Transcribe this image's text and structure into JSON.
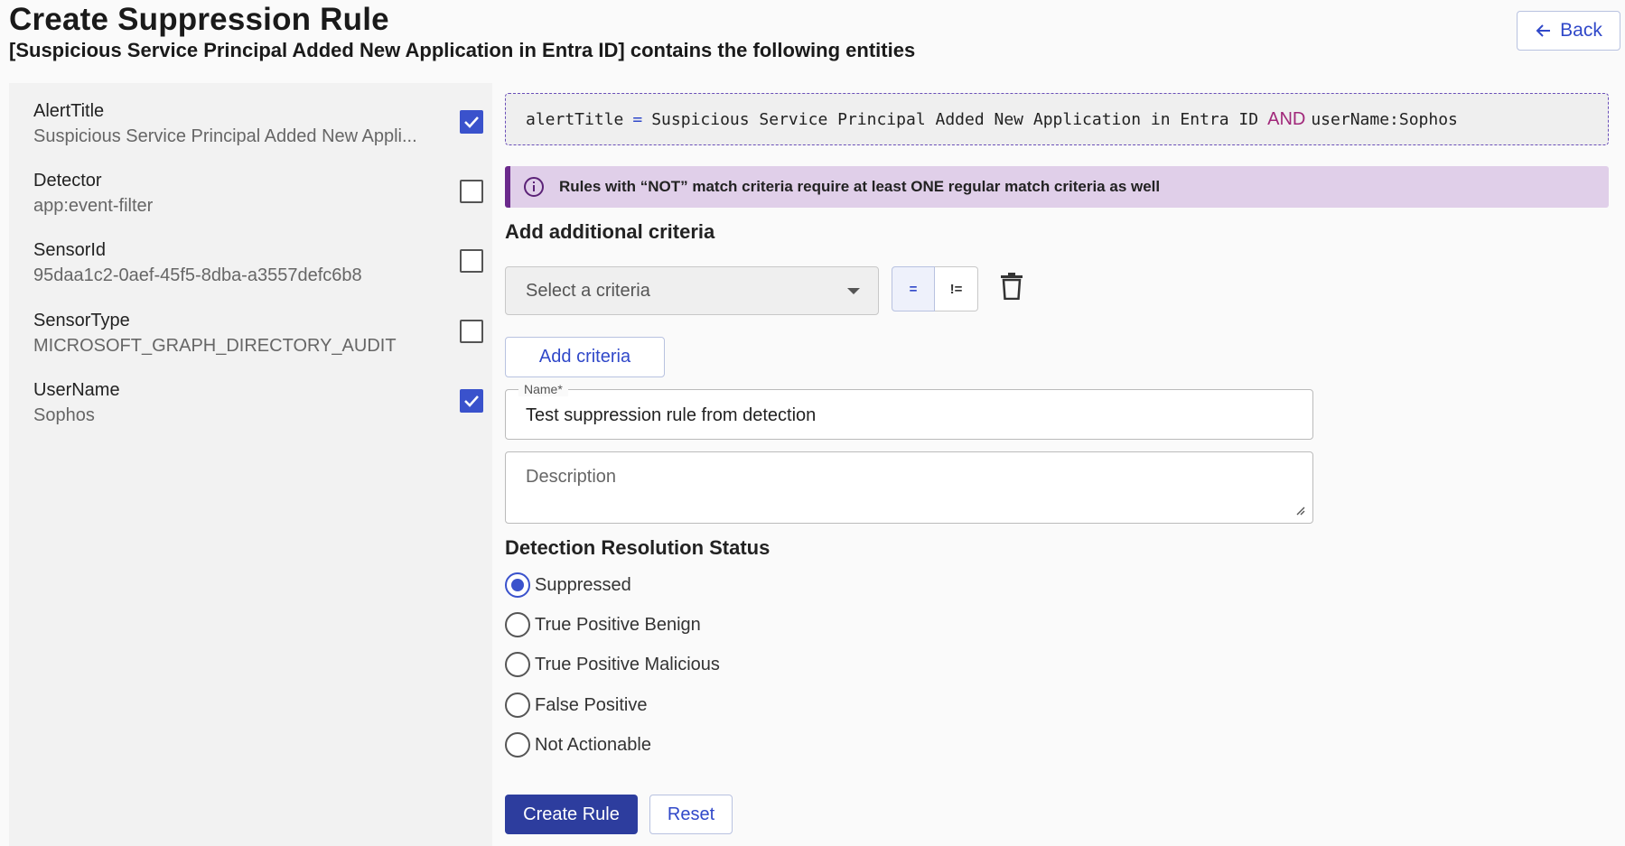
{
  "header": {
    "title": "Create Suppression Rule",
    "subtitle": "[Suspicious Service Principal Added New Application in Entra ID] contains the following entities",
    "back_label": "Back"
  },
  "entities": [
    {
      "key": "AlertTitle",
      "value": "Suspicious Service Principal Added New Appli...",
      "checked": true
    },
    {
      "key": "Detector",
      "value": "app:event-filter",
      "checked": false
    },
    {
      "key": "SensorId",
      "value": "95daa1c2-0aef-45f5-8dba-a3557defc6b8",
      "checked": false
    },
    {
      "key": "SensorType",
      "value": "MICROSOFT_GRAPH_DIRECTORY_AUDIT",
      "checked": false
    },
    {
      "key": "UserName",
      "value": "Sophos",
      "checked": true
    }
  ],
  "query": {
    "field1": "alertTitle",
    "op1": "=",
    "value1": "Suspicious Service Principal Added New Application in Entra ID",
    "joiner": "AND",
    "clause2": "userName:Sophos"
  },
  "info_banner": {
    "text": "Rules with “NOT” match criteria require at least ONE regular match criteria as well"
  },
  "criteria": {
    "section_title": "Add additional criteria",
    "select_placeholder": "Select a criteria",
    "op_equals": "=",
    "op_not_equals": "!=",
    "add_label": "Add criteria"
  },
  "form": {
    "name_label": "Name*",
    "name_value": "Test suppression rule from detection",
    "description_placeholder": "Description"
  },
  "resolution": {
    "title": "Detection Resolution Status",
    "options": [
      {
        "label": "Suppressed",
        "selected": true
      },
      {
        "label": "True Positive Benign",
        "selected": false
      },
      {
        "label": "True Positive Malicious",
        "selected": false
      },
      {
        "label": "False Positive",
        "selected": false
      },
      {
        "label": "Not Actionable",
        "selected": false
      }
    ]
  },
  "actions": {
    "create_label": "Create Rule",
    "reset_label": "Reset"
  },
  "colors": {
    "accent": "#3a52cc",
    "primary_button": "#2d3d9e",
    "banner_bg": "#e0cfe9",
    "banner_border": "#6b2a8c"
  }
}
